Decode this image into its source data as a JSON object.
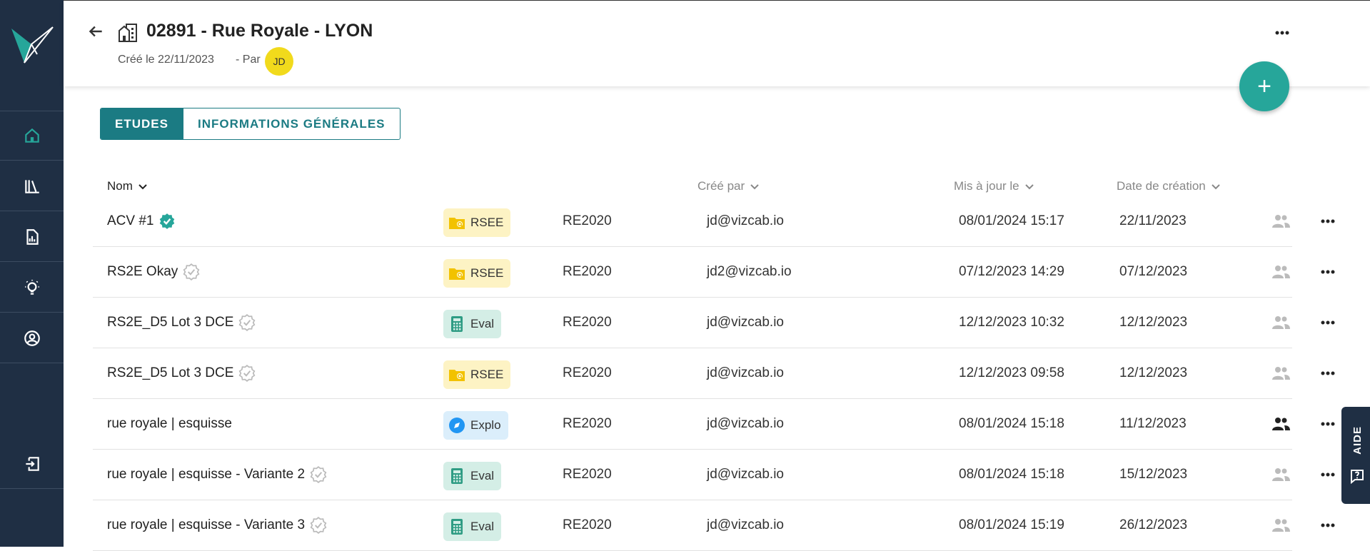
{
  "header": {
    "title": "02891 - Rue Royale - LYON",
    "created": "Créé le 22/11/2023",
    "by": "- Par",
    "avatar": "JD"
  },
  "fab_label": "+",
  "tabs": [
    {
      "label": "ETUDES",
      "active": true
    },
    {
      "label": "INFORMATIONS GÉNÉRALES",
      "active": false
    }
  ],
  "columns": {
    "name": "Nom",
    "created_by": "Créé par",
    "updated": "Mis à jour le",
    "created": "Date de création"
  },
  "rows": [
    {
      "name": "ACV #1",
      "verified": "verified-filled",
      "type": "RSEE",
      "norm": "RE2020",
      "user": "jd@vizcab.io",
      "updated": "08/01/2024 15:17",
      "created": "22/11/2023",
      "shared": false
    },
    {
      "name": "RS2E Okay",
      "verified": "verified-outline",
      "type": "RSEE",
      "norm": "RE2020",
      "user": "jd2@vizcab.io",
      "updated": "07/12/2023 14:29",
      "created": "07/12/2023",
      "shared": false
    },
    {
      "name": "RS2E_D5 Lot 3 DCE",
      "verified": "verified-outline",
      "type": "Eval",
      "norm": "RE2020",
      "user": "jd@vizcab.io",
      "updated": "12/12/2023 10:32",
      "created": "12/12/2023",
      "shared": false
    },
    {
      "name": "RS2E_D5 Lot 3 DCE",
      "verified": "verified-outline",
      "type": "RSEE",
      "norm": "RE2020",
      "user": "jd@vizcab.io",
      "updated": "12/12/2023 09:58",
      "created": "12/12/2023",
      "shared": false
    },
    {
      "name": "rue royale | esquisse",
      "verified": "none",
      "type": "Explo",
      "norm": "RE2020",
      "user": "jd@vizcab.io",
      "updated": "08/01/2024 15:18",
      "created": "11/12/2023",
      "shared": true
    },
    {
      "name": "rue royale | esquisse - Variante 2",
      "verified": "verified-outline",
      "type": "Eval",
      "norm": "RE2020",
      "user": "jd@vizcab.io",
      "updated": "08/01/2024 15:18",
      "created": "15/12/2023",
      "shared": false
    },
    {
      "name": "rue royale | esquisse - Variante 3",
      "verified": "verified-outline",
      "type": "Eval",
      "norm": "RE2020",
      "user": "jd@vizcab.io",
      "updated": "08/01/2024 15:19",
      "created": "26/12/2023",
      "shared": false
    }
  ],
  "help_label": "AIDE",
  "colors": {
    "sidebar": "#1f2f44",
    "accent": "#26a69a",
    "teal": "#1b7b83",
    "rsee": "#fdf3c4",
    "eval": "#d4eee6",
    "explo": "#dbeefb"
  }
}
